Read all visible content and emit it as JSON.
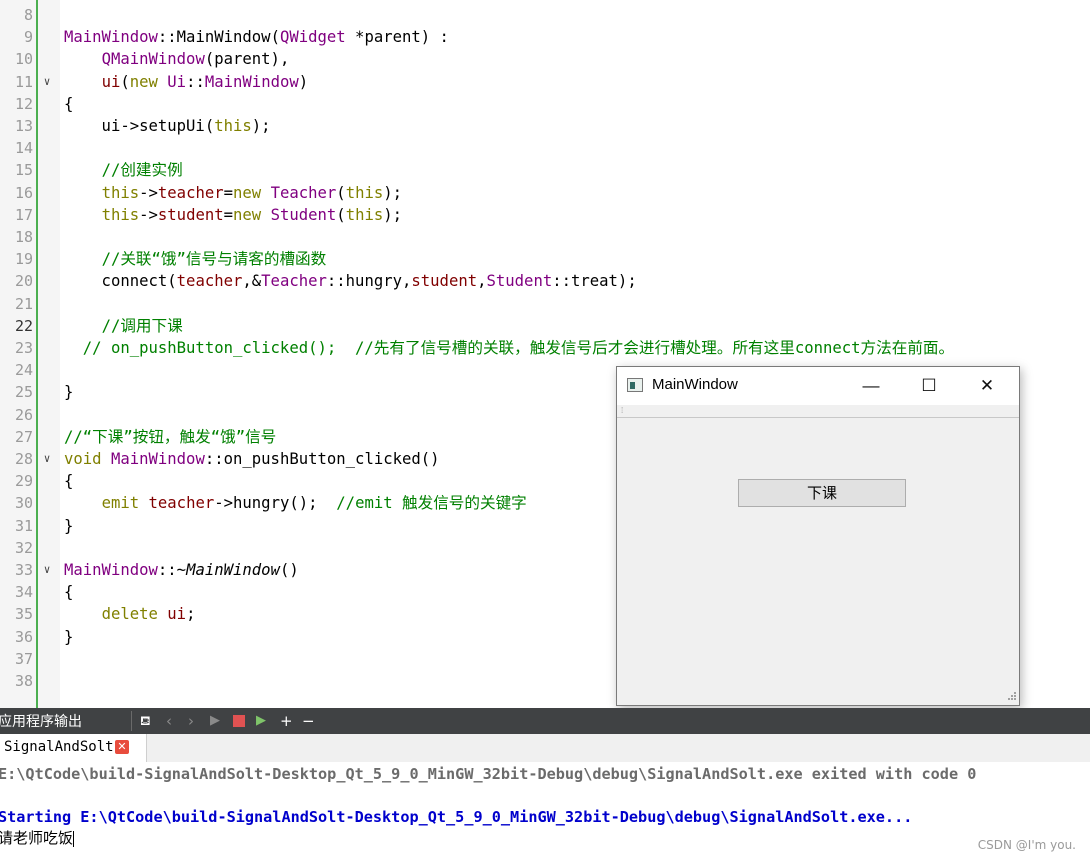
{
  "editor": {
    "lines": [
      {
        "n": "8",
        "current": false,
        "fold": false,
        "segments": []
      },
      {
        "n": "9",
        "current": false,
        "fold": false,
        "segments": [
          {
            "t": "MainWindow",
            "c": "t"
          },
          {
            "t": "::",
            "c": ""
          },
          {
            "t": "MainWindow",
            "c": ""
          },
          {
            "t": "(",
            "c": ""
          },
          {
            "t": "QWidget",
            "c": "t"
          },
          {
            "t": " *parent) :",
            "c": ""
          }
        ]
      },
      {
        "n": "10",
        "current": false,
        "fold": false,
        "segments": [
          {
            "t": "    ",
            "c": ""
          },
          {
            "t": "QMainWindow",
            "c": "t"
          },
          {
            "t": "(parent),",
            "c": ""
          }
        ]
      },
      {
        "n": "11",
        "current": false,
        "fold": true,
        "segments": [
          {
            "t": "    ",
            "c": ""
          },
          {
            "t": "ui",
            "c": "m"
          },
          {
            "t": "(",
            "c": ""
          },
          {
            "t": "new",
            "c": "k"
          },
          {
            "t": " ",
            "c": ""
          },
          {
            "t": "Ui",
            "c": "t"
          },
          {
            "t": "::",
            "c": ""
          },
          {
            "t": "MainWindow",
            "c": "t"
          },
          {
            "t": ")",
            "c": ""
          }
        ]
      },
      {
        "n": "12",
        "current": false,
        "fold": false,
        "segments": [
          {
            "t": "{",
            "c": ""
          }
        ]
      },
      {
        "n": "13",
        "current": false,
        "fold": false,
        "segments": [
          {
            "t": "    ui->setupUi(",
            "c": ""
          },
          {
            "t": "this",
            "c": "k"
          },
          {
            "t": ");",
            "c": ""
          }
        ]
      },
      {
        "n": "14",
        "current": false,
        "fold": false,
        "segments": []
      },
      {
        "n": "15",
        "current": false,
        "fold": false,
        "segments": [
          {
            "t": "    ",
            "c": ""
          },
          {
            "t": "//创建实例",
            "c": "c"
          }
        ]
      },
      {
        "n": "16",
        "current": false,
        "fold": false,
        "segments": [
          {
            "t": "    ",
            "c": ""
          },
          {
            "t": "this",
            "c": "k"
          },
          {
            "t": "->",
            "c": ""
          },
          {
            "t": "teacher",
            "c": "m"
          },
          {
            "t": "=",
            "c": ""
          },
          {
            "t": "new",
            "c": "k"
          },
          {
            "t": " ",
            "c": ""
          },
          {
            "t": "Teacher",
            "c": "t"
          },
          {
            "t": "(",
            "c": ""
          },
          {
            "t": "this",
            "c": "k"
          },
          {
            "t": ");",
            "c": ""
          }
        ]
      },
      {
        "n": "17",
        "current": false,
        "fold": false,
        "segments": [
          {
            "t": "    ",
            "c": ""
          },
          {
            "t": "this",
            "c": "k"
          },
          {
            "t": "->",
            "c": ""
          },
          {
            "t": "student",
            "c": "m"
          },
          {
            "t": "=",
            "c": ""
          },
          {
            "t": "new",
            "c": "k"
          },
          {
            "t": " ",
            "c": ""
          },
          {
            "t": "Student",
            "c": "t"
          },
          {
            "t": "(",
            "c": ""
          },
          {
            "t": "this",
            "c": "k"
          },
          {
            "t": ");",
            "c": ""
          }
        ]
      },
      {
        "n": "18",
        "current": false,
        "fold": false,
        "segments": []
      },
      {
        "n": "19",
        "current": false,
        "fold": false,
        "segments": [
          {
            "t": "    ",
            "c": ""
          },
          {
            "t": "//关联“饿”信号与请客的槽函数",
            "c": "c"
          }
        ]
      },
      {
        "n": "20",
        "current": false,
        "fold": false,
        "segments": [
          {
            "t": "    connect(",
            "c": ""
          },
          {
            "t": "teacher",
            "c": "m"
          },
          {
            "t": ",&",
            "c": ""
          },
          {
            "t": "Teacher",
            "c": "t"
          },
          {
            "t": "::hungry,",
            "c": ""
          },
          {
            "t": "student",
            "c": "m"
          },
          {
            "t": ",",
            "c": ""
          },
          {
            "t": "Student",
            "c": "t"
          },
          {
            "t": "::treat);",
            "c": ""
          }
        ]
      },
      {
        "n": "21",
        "current": false,
        "fold": false,
        "segments": []
      },
      {
        "n": "22",
        "current": true,
        "fold": false,
        "segments": [
          {
            "t": "    ",
            "c": ""
          },
          {
            "t": "//调用下课",
            "c": "c"
          }
        ]
      },
      {
        "n": "23",
        "current": false,
        "fold": false,
        "segments": [
          {
            "t": "  // on_pushButton_clicked();  //先有了信号槽的关联，触发信号后才会进行槽处理。所有这里connect方法在前面。",
            "c": "c"
          }
        ]
      },
      {
        "n": "24",
        "current": false,
        "fold": false,
        "segments": []
      },
      {
        "n": "25",
        "current": false,
        "fold": false,
        "segments": [
          {
            "t": "}",
            "c": ""
          }
        ]
      },
      {
        "n": "26",
        "current": false,
        "fold": false,
        "segments": []
      },
      {
        "n": "27",
        "current": false,
        "fold": false,
        "segments": [
          {
            "t": "//“下课”按钮，触发“饿”信号",
            "c": "c"
          }
        ]
      },
      {
        "n": "28",
        "current": false,
        "fold": true,
        "segments": [
          {
            "t": "void",
            "c": "k"
          },
          {
            "t": " ",
            "c": ""
          },
          {
            "t": "MainWindow",
            "c": "t"
          },
          {
            "t": "::on_pushButton_clicked()",
            "c": ""
          }
        ]
      },
      {
        "n": "29",
        "current": false,
        "fold": false,
        "segments": [
          {
            "t": "{",
            "c": ""
          }
        ]
      },
      {
        "n": "30",
        "current": false,
        "fold": false,
        "segments": [
          {
            "t": "    ",
            "c": ""
          },
          {
            "t": "emit",
            "c": "k"
          },
          {
            "t": " ",
            "c": ""
          },
          {
            "t": "teacher",
            "c": "m"
          },
          {
            "t": "->hungry();  ",
            "c": ""
          },
          {
            "t": "//emit 触发信号的关键字",
            "c": "c"
          }
        ]
      },
      {
        "n": "31",
        "current": false,
        "fold": false,
        "segments": [
          {
            "t": "}",
            "c": ""
          }
        ]
      },
      {
        "n": "32",
        "current": false,
        "fold": false,
        "segments": []
      },
      {
        "n": "33",
        "current": false,
        "fold": true,
        "segments": [
          {
            "t": "MainWindow",
            "c": "t"
          },
          {
            "t": "::~",
            "c": ""
          },
          {
            "t": "MainWindow",
            "c": "i"
          },
          {
            "t": "()",
            "c": ""
          }
        ]
      },
      {
        "n": "34",
        "current": false,
        "fold": false,
        "segments": [
          {
            "t": "{",
            "c": ""
          }
        ]
      },
      {
        "n": "35",
        "current": false,
        "fold": false,
        "segments": [
          {
            "t": "    ",
            "c": ""
          },
          {
            "t": "delete",
            "c": "k"
          },
          {
            "t": " ",
            "c": ""
          },
          {
            "t": "ui",
            "c": "m"
          },
          {
            "t": ";",
            "c": ""
          }
        ]
      },
      {
        "n": "36",
        "current": false,
        "fold": false,
        "segments": [
          {
            "t": "}",
            "c": ""
          }
        ]
      },
      {
        "n": "37",
        "current": false,
        "fold": false,
        "segments": []
      },
      {
        "n": "38",
        "current": false,
        "fold": false,
        "segments": []
      }
    ]
  },
  "window": {
    "title": "MainWindow",
    "minimize_glyph": "—",
    "maximize_glyph": "☐",
    "close_glyph": "✕",
    "button_label": "下课"
  },
  "panel": {
    "title": "应用程序输出",
    "tab_label": "SignalAndSolt",
    "tab_close_glyph": "✕",
    "toolbar_icons": [
      "pin-icon",
      "prev-icon",
      "next-icon",
      "run-icon",
      "stop-icon",
      "rerun-icon",
      "add-icon",
      "remove-icon"
    ]
  },
  "output": {
    "line1": "E:\\QtCode\\build-SignalAndSolt-Desktop_Qt_5_9_0_MinGW_32bit-Debug\\debug\\SignalAndSolt.exe exited with code 0",
    "line2": "Starting E:\\QtCode\\build-SignalAndSolt-Desktop_Qt_5_9_0_MinGW_32bit-Debug\\debug\\SignalAndSolt.exe...",
    "line3": "请老师吃饭"
  },
  "watermark": "CSDN @I'm you."
}
